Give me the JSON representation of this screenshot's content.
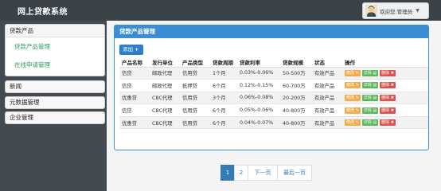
{
  "app": {
    "title": "网上贷款系统"
  },
  "user": {
    "label": "欢迎您:管理员"
  },
  "sidebar": {
    "groups": [
      {
        "label": "贷款产品",
        "items": [
          "贷款产品管理",
          "在线申请管理"
        ]
      },
      {
        "label": "新闻"
      },
      {
        "label": "元数据管理"
      },
      {
        "label": "企业管理"
      }
    ]
  },
  "panel": {
    "title": "贷款产品管理",
    "add_label": "添加",
    "columns": [
      "产品名称",
      "发行单位",
      "产品类型",
      "贷款周期",
      "贷款利率",
      "贷款规模",
      "状态",
      "操作"
    ],
    "rows": [
      [
        "信贷",
        "邮政代理",
        "信用贷",
        "1个月",
        "0.03%-0.06%",
        "50-500万",
        "有效产品"
      ],
      [
        "信贷",
        "邮政代理",
        "抵押贷",
        "6个月",
        "0.12%-0.15%",
        "60-700万",
        "有效产品"
      ],
      [
        "优惠贷",
        "CBC代理",
        "信用贷",
        "3个月",
        "0.06%-0.08%",
        "20-200万",
        "有效产品"
      ],
      [
        "信贷",
        "CBC代理",
        "信用贷",
        "6个月",
        "0.05%-0.06%",
        "40-800万",
        "有效产品"
      ],
      [
        "优惠贷",
        "CBC代理",
        "信用贷",
        "6个月",
        "0.04%-0.07%",
        "40-800万",
        "有效产品"
      ]
    ],
    "actions": {
      "edit": "修改",
      "detail": "详情",
      "delete": "删除"
    }
  },
  "pager": {
    "items": [
      "1",
      "2",
      "下一页",
      "最后一页"
    ],
    "active": "1"
  },
  "colors": {
    "topbar": "#3b4349",
    "sidebar_bg": "#444a51",
    "panel_accent": "#3b8ed4",
    "submenu_text": "#2a9a5a"
  },
  "icons": [
    "avatar",
    "caret-down-icon",
    "plus-icon",
    "edit-icon",
    "detail-icon",
    "delete-icon"
  ]
}
